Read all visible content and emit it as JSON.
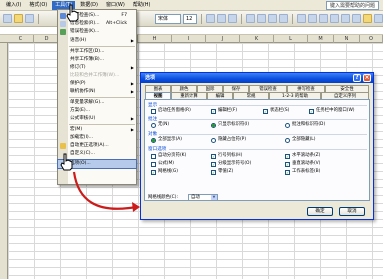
{
  "menubar": {
    "items": [
      "编入(I)",
      "格式(O)",
      "工具(T)",
      "数据(D)",
      "窗口(W)",
      "帮助(H)"
    ],
    "help_placeholder": "键入需要帮助的问题"
  },
  "toolbar": {
    "zoom": "宋体",
    "font_size": "12"
  },
  "column_headers": [
    "C",
    "D",
    "E",
    "F",
    "G",
    "H",
    "I",
    "J",
    "K",
    "L",
    "M",
    "N",
    "O"
  ],
  "tools_menu": {
    "items": [
      {
        "label": "拼写检查(S)...",
        "shortcut": "F7",
        "submenu": false,
        "disabled": false
      },
      {
        "label": "信息检索(R)...",
        "shortcut": "Alt+Click",
        "submenu": false,
        "disabled": false
      },
      {
        "label": "错误检查(K)...",
        "shortcut": "",
        "submenu": false,
        "disabled": false
      },
      {
        "label": "语音(H)",
        "shortcut": "",
        "submenu": true,
        "disabled": false
      },
      {
        "label": "共享工作区(D)...",
        "shortcut": "",
        "submenu": false,
        "disabled": false
      },
      {
        "label": "共享工作簿(B)...",
        "shortcut": "",
        "submenu": false,
        "disabled": false
      },
      {
        "label": "修订(T)",
        "shortcut": "",
        "submenu": true,
        "disabled": false
      },
      {
        "label": "比较和合并工作簿(W)...",
        "shortcut": "",
        "submenu": false,
        "disabled": true
      },
      {
        "label": "保护(P)",
        "shortcut": "",
        "submenu": true,
        "disabled": false
      },
      {
        "label": "联机协作(N)",
        "shortcut": "",
        "submenu": true,
        "disabled": false
      },
      {
        "label": "单变量求解(G)...",
        "shortcut": "",
        "submenu": false,
        "disabled": false
      },
      {
        "label": "方案(E)...",
        "shortcut": "",
        "submenu": false,
        "disabled": false
      },
      {
        "label": "公式审核(U)",
        "shortcut": "",
        "submenu": true,
        "disabled": false
      },
      {
        "label": "宏(M)",
        "shortcut": "",
        "submenu": true,
        "disabled": false
      },
      {
        "label": "加载宏(I)...",
        "shortcut": "",
        "submenu": false,
        "disabled": false
      },
      {
        "label": "自动更正选项(A)...",
        "shortcut": "",
        "submenu": false,
        "disabled": false
      },
      {
        "label": "自定义(C)...",
        "shortcut": "",
        "submenu": false,
        "disabled": false
      },
      {
        "label": "选项(O)...",
        "shortcut": "",
        "submenu": false,
        "disabled": false
      }
    ]
  },
  "options_dialog": {
    "title": "选项",
    "tabs_row1": [
      "图表",
      "颜色",
      "国际",
      "保存",
      "错误检查",
      "拼写检查",
      "安全性"
    ],
    "tabs_row2": [
      "视图",
      "重新计算",
      "编辑",
      "常规",
      "1-2-3 的帮助",
      "自定义序列"
    ],
    "sections": {
      "show": {
        "label": "显示",
        "options": [
          {
            "label": "启动任务窗格(R)",
            "checked": false
          },
          {
            "label": "编辑栏(F)",
            "checked": true
          },
          {
            "label": "状态栏(S)",
            "checked": true
          },
          {
            "label": "任务栏中的窗口(W)",
            "checked": true
          }
        ]
      },
      "comments": {
        "label": "批注",
        "options": [
          {
            "label": "无(N)",
            "selected": false
          },
          {
            "label": "只显示标识符(I)",
            "selected": true
          },
          {
            "label": "批注和标识符(D)",
            "selected": false
          }
        ]
      },
      "objects": {
        "label": "对象",
        "options": [
          {
            "label": "全部显示(A)",
            "selected": true
          },
          {
            "label": "隐藏占位符(P)",
            "selected": false
          },
          {
            "label": "全部隐藏(L)",
            "selected": false
          }
        ]
      },
      "window_options": {
        "label": "窗口选项",
        "options": [
          {
            "label": "自动分页符(K)",
            "checked": false
          },
          {
            "label": "行号列标(H)",
            "checked": true
          },
          {
            "label": "水平滚动条(Z)",
            "checked": true
          },
          {
            "label": "公式(M)",
            "checked": false
          },
          {
            "label": "分级显示符号(O)",
            "checked": true
          },
          {
            "label": "垂直滚动条(V)",
            "checked": true
          },
          {
            "label": "网格线(G)",
            "checked": true
          },
          {
            "label": "零值(Z)",
            "checked": true
          },
          {
            "label": "工作表标签(B)",
            "checked": true
          }
        ],
        "gridline_color_label": "网格线颜色(C):",
        "gridline_color_value": "自动"
      }
    },
    "ok_label": "确定",
    "cancel_label": "取消"
  },
  "colors": {
    "menu_highlight": "#316ac5",
    "dialog_titlebar": "#0a4ee0",
    "annotation_arrow": "#cc1b1b",
    "cursor_fill": "#ffffff"
  }
}
